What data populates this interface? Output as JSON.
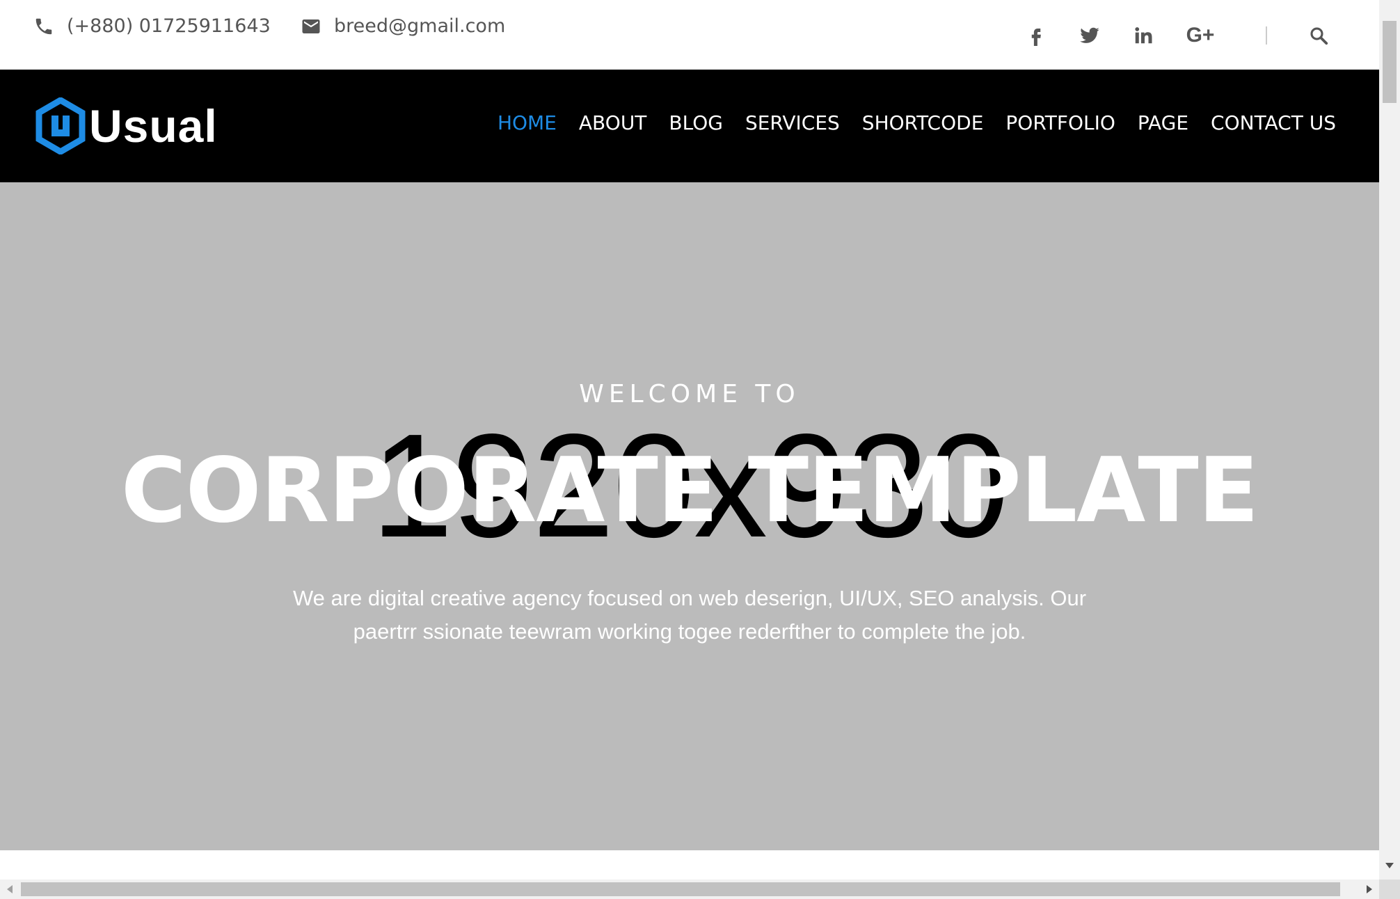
{
  "topbar": {
    "phone": "(+880) 01725911643",
    "email": "breed@gmail.com",
    "social": [
      {
        "name": "facebook",
        "icon": "facebook-icon"
      },
      {
        "name": "twitter",
        "icon": "twitter-icon"
      },
      {
        "name": "linkedin",
        "icon": "linkedin-icon"
      },
      {
        "name": "google-plus",
        "label": "G+"
      }
    ]
  },
  "brand": {
    "name": "Usual",
    "logo_color": "#1e8ce5"
  },
  "nav": {
    "items": [
      "HOME",
      "ABOUT",
      "BLOG",
      "SERVICES",
      "SHORTCODE",
      "PORTFOLIO",
      "PAGE",
      "CONTACT US"
    ],
    "active": "HOME",
    "active_color": "#1e8ce5"
  },
  "hero": {
    "placeholder": "1920x930",
    "welcome": "WELCOME TO",
    "headline": "CORPORATE TEMPLATE",
    "tagline_line1": "We are digital creative agency focused on web deserign, UI/UX, SEO analysis. Our",
    "tagline_line2": "paertrr ssionate teewram working togee rederfther to complete the job.",
    "background": "#bbbbbb"
  }
}
